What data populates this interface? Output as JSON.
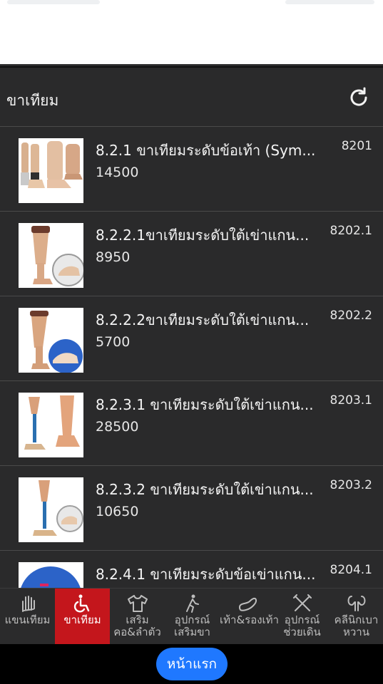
{
  "header": {
    "title": "ขาเทียม",
    "refresh_icon": "refresh-icon"
  },
  "items": [
    {
      "name": "8.2.1 ขาเทียมระดับข้อเท้า (Sym...",
      "price": "14500",
      "code": "8201"
    },
    {
      "name": "8.2.2.1ขาเทียมระดับใต้เข่าแกน...",
      "price": "8950",
      "code": "8202.1"
    },
    {
      "name": "8.2.2.2ขาเทียมระดับใต้เข่าแกน...",
      "price": "5700",
      "code": "8202.2"
    },
    {
      "name": "8.2.3.1 ขาเทียมระดับใต้เข่าแกน...",
      "price": "28500",
      "code": "8203.1"
    },
    {
      "name": "8.2.3.2 ขาเทียมระดับใต้เข่าแกน...",
      "price": "10650",
      "code": "8203.2"
    },
    {
      "name": "8.2.4.1 ขาเทียมระดับข้อเข่าแกน...",
      "price": "",
      "code": "8204.1"
    }
  ],
  "tabs": [
    {
      "line1": "แขนเทียม",
      "line2": "",
      "icon": "hand-icon"
    },
    {
      "line1": "ขาเทียม",
      "line2": "",
      "icon": "wheelchair-icon",
      "active": true
    },
    {
      "line1": "เสริม",
      "line2": "คอ&ลำตัว",
      "icon": "shirt-icon"
    },
    {
      "line1": "อุปกรณ์",
      "line2": "เสริมขา",
      "icon": "walking-icon"
    },
    {
      "line1": "เท้า&รองเท้า",
      "line2": "",
      "icon": "insole-icon"
    },
    {
      "line1": "อุปกรณ์",
      "line2": "ช่วยเดิน",
      "icon": "crutches-icon"
    },
    {
      "line1": "คลีนิกเบา",
      "line2": "หวาน",
      "icon": "kidney-icon"
    }
  ],
  "footer": {
    "home_label": "หน้าแรก"
  },
  "colors": {
    "background": "#2a2a2b",
    "active_tab": "#c4161c",
    "home_button": "#1f78ff"
  }
}
